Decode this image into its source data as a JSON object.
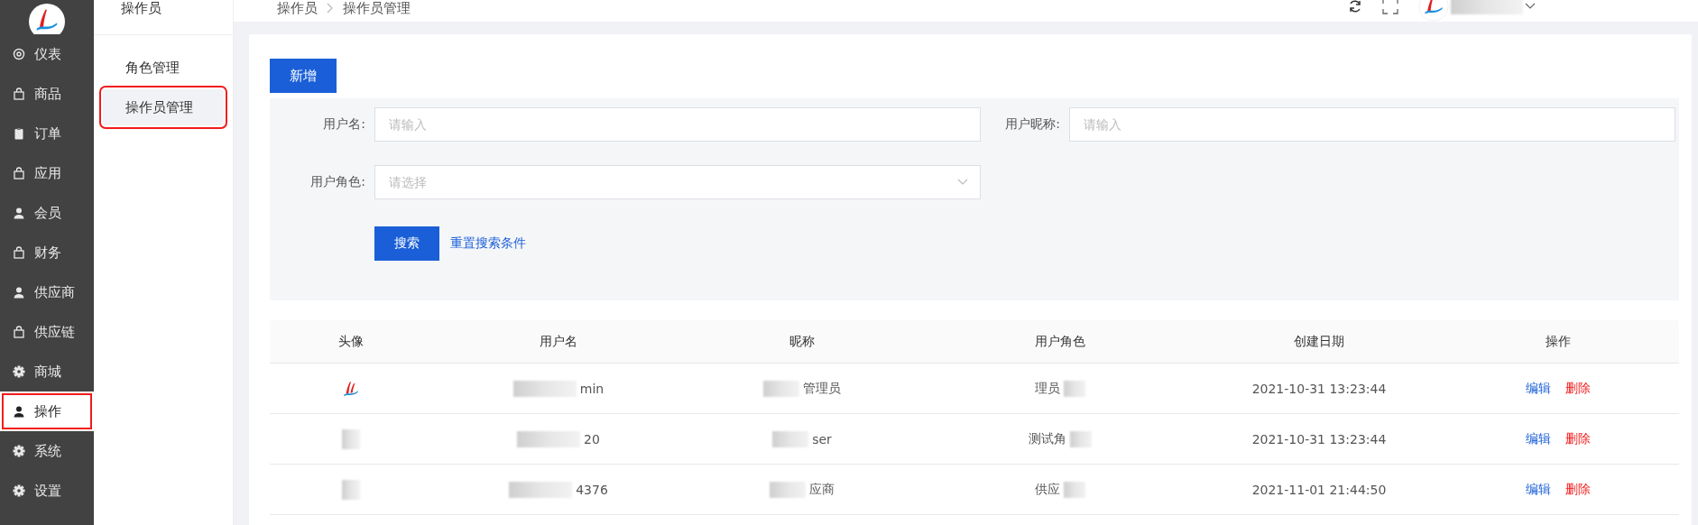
{
  "sidebar": {
    "items": [
      {
        "label": "仪表",
        "kind": "dashboard",
        "selected": false
      },
      {
        "label": "商品",
        "kind": "bag",
        "selected": false
      },
      {
        "label": "订单",
        "kind": "clipboard",
        "selected": false
      },
      {
        "label": "应用",
        "kind": "bag",
        "selected": false
      },
      {
        "label": "会员",
        "kind": "user",
        "selected": false
      },
      {
        "label": "财务",
        "kind": "bag",
        "selected": false
      },
      {
        "label": "供应商",
        "kind": "user",
        "selected": false
      },
      {
        "label": "供应链",
        "kind": "bag",
        "selected": false
      },
      {
        "label": "商城",
        "kind": "gear",
        "selected": false
      },
      {
        "label": "操作",
        "kind": "user",
        "selected": true
      },
      {
        "label": "系统",
        "kind": "gear",
        "selected": false
      },
      {
        "label": "设置",
        "kind": "gear",
        "selected": false
      }
    ]
  },
  "submenu": {
    "title": "操作员",
    "items": [
      {
        "label": "角色管理",
        "selected": false
      },
      {
        "label": "操作员管理",
        "selected": true
      }
    ]
  },
  "breadcrumb": [
    "操作员",
    "操作员管理"
  ],
  "add_button": "新增",
  "filters": [
    {
      "label": "用户名:",
      "placeholder": "请输入",
      "kind": "input"
    },
    {
      "label": "用户昵称:",
      "placeholder": "请输入",
      "kind": "input"
    },
    {
      "label": "用户角色:",
      "placeholder": "请选择",
      "kind": "select"
    }
  ],
  "search_button": "搜索",
  "reset_link": "重置搜索条件",
  "table": {
    "columns": [
      "头像",
      "用户名",
      "昵称",
      "用户角色",
      "创建日期",
      "操作"
    ],
    "rows": [
      {
        "kind": "logo",
        "username": "min",
        "nickname": "管理员",
        "role": "理员",
        "created": "2021-10-31 13:23:44",
        "actions": [
          "编辑",
          "删除"
        ]
      },
      {
        "kind": "blurred",
        "username": "20",
        "nickname": "ser",
        "role": "测试角",
        "created": "2021-10-31 13:23:44",
        "actions": [
          "编辑",
          "删除"
        ]
      },
      {
        "kind": "blurred",
        "username": "4376",
        "nickname": "应商",
        "role": "供应",
        "created": "2021-11-01 21:44:50",
        "actions": [
          "编辑",
          "删除"
        ]
      }
    ]
  }
}
